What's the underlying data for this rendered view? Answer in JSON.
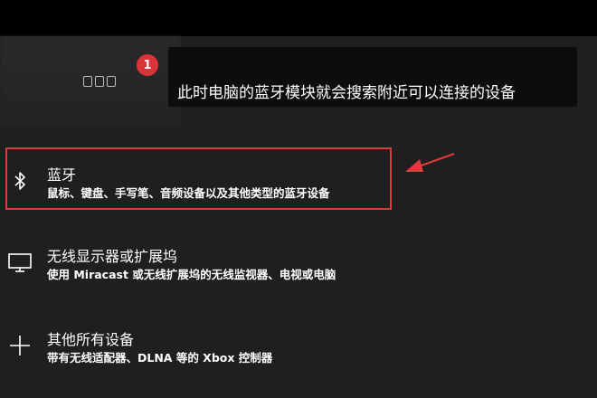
{
  "step_badge": "1",
  "tooltip_text": "此时电脑的蓝牙模块就会搜索附近可以连接的设备",
  "options": [
    {
      "title": "蓝牙",
      "description": "鼠标、键盘、手写笔、音频设备以及其他类型的蓝牙设备",
      "icon": "bluetooth-icon"
    },
    {
      "title": "无线显示器或扩展坞",
      "description": "使用 Miracast 或无线扩展坞的无线监视器、电视或电脑",
      "icon": "monitor-icon"
    },
    {
      "title": "其他所有设备",
      "description": "带有无线适配器、DLNA 等的 Xbox 控制器",
      "icon": "plus-icon"
    }
  ],
  "colors": {
    "background": "#1f1f1f",
    "top_bar": "#000000",
    "tooltip_bg": "#0d0d0d",
    "highlight": "#e03a3f",
    "badge": "#d9343a"
  }
}
